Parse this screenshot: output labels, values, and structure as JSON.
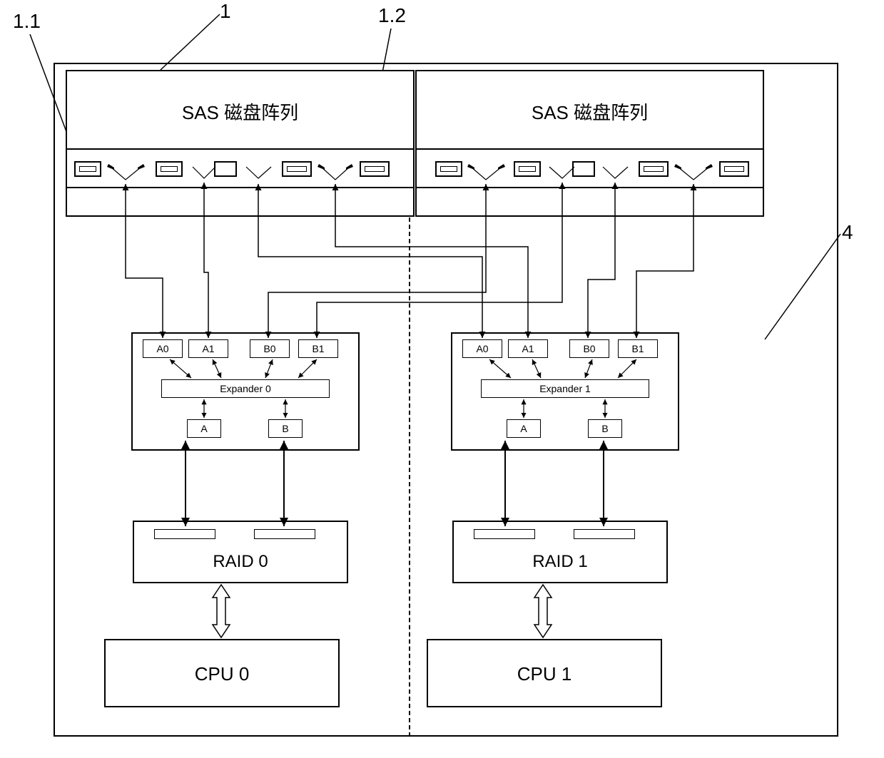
{
  "labels": {
    "ref_1_1": "1.1",
    "ref_1": "1",
    "ref_1_2": "1.2",
    "ref_4": "4"
  },
  "arrays": {
    "left": "SAS 磁盘阵列",
    "right": "SAS 磁盘阵列"
  },
  "expander": {
    "left": {
      "ports_top": [
        "A0",
        "A1",
        "B0",
        "B1"
      ],
      "name": "Expander 0",
      "ports_bottom": [
        "A",
        "B"
      ]
    },
    "right": {
      "ports_top": [
        "A0",
        "A1",
        "B0",
        "B1"
      ],
      "name": "Expander 1",
      "ports_bottom": [
        "A",
        "B"
      ]
    }
  },
  "raid": {
    "left": "RAID 0",
    "right": "RAID 1"
  },
  "cpu": {
    "left": "CPU 0",
    "right": "CPU 1"
  }
}
